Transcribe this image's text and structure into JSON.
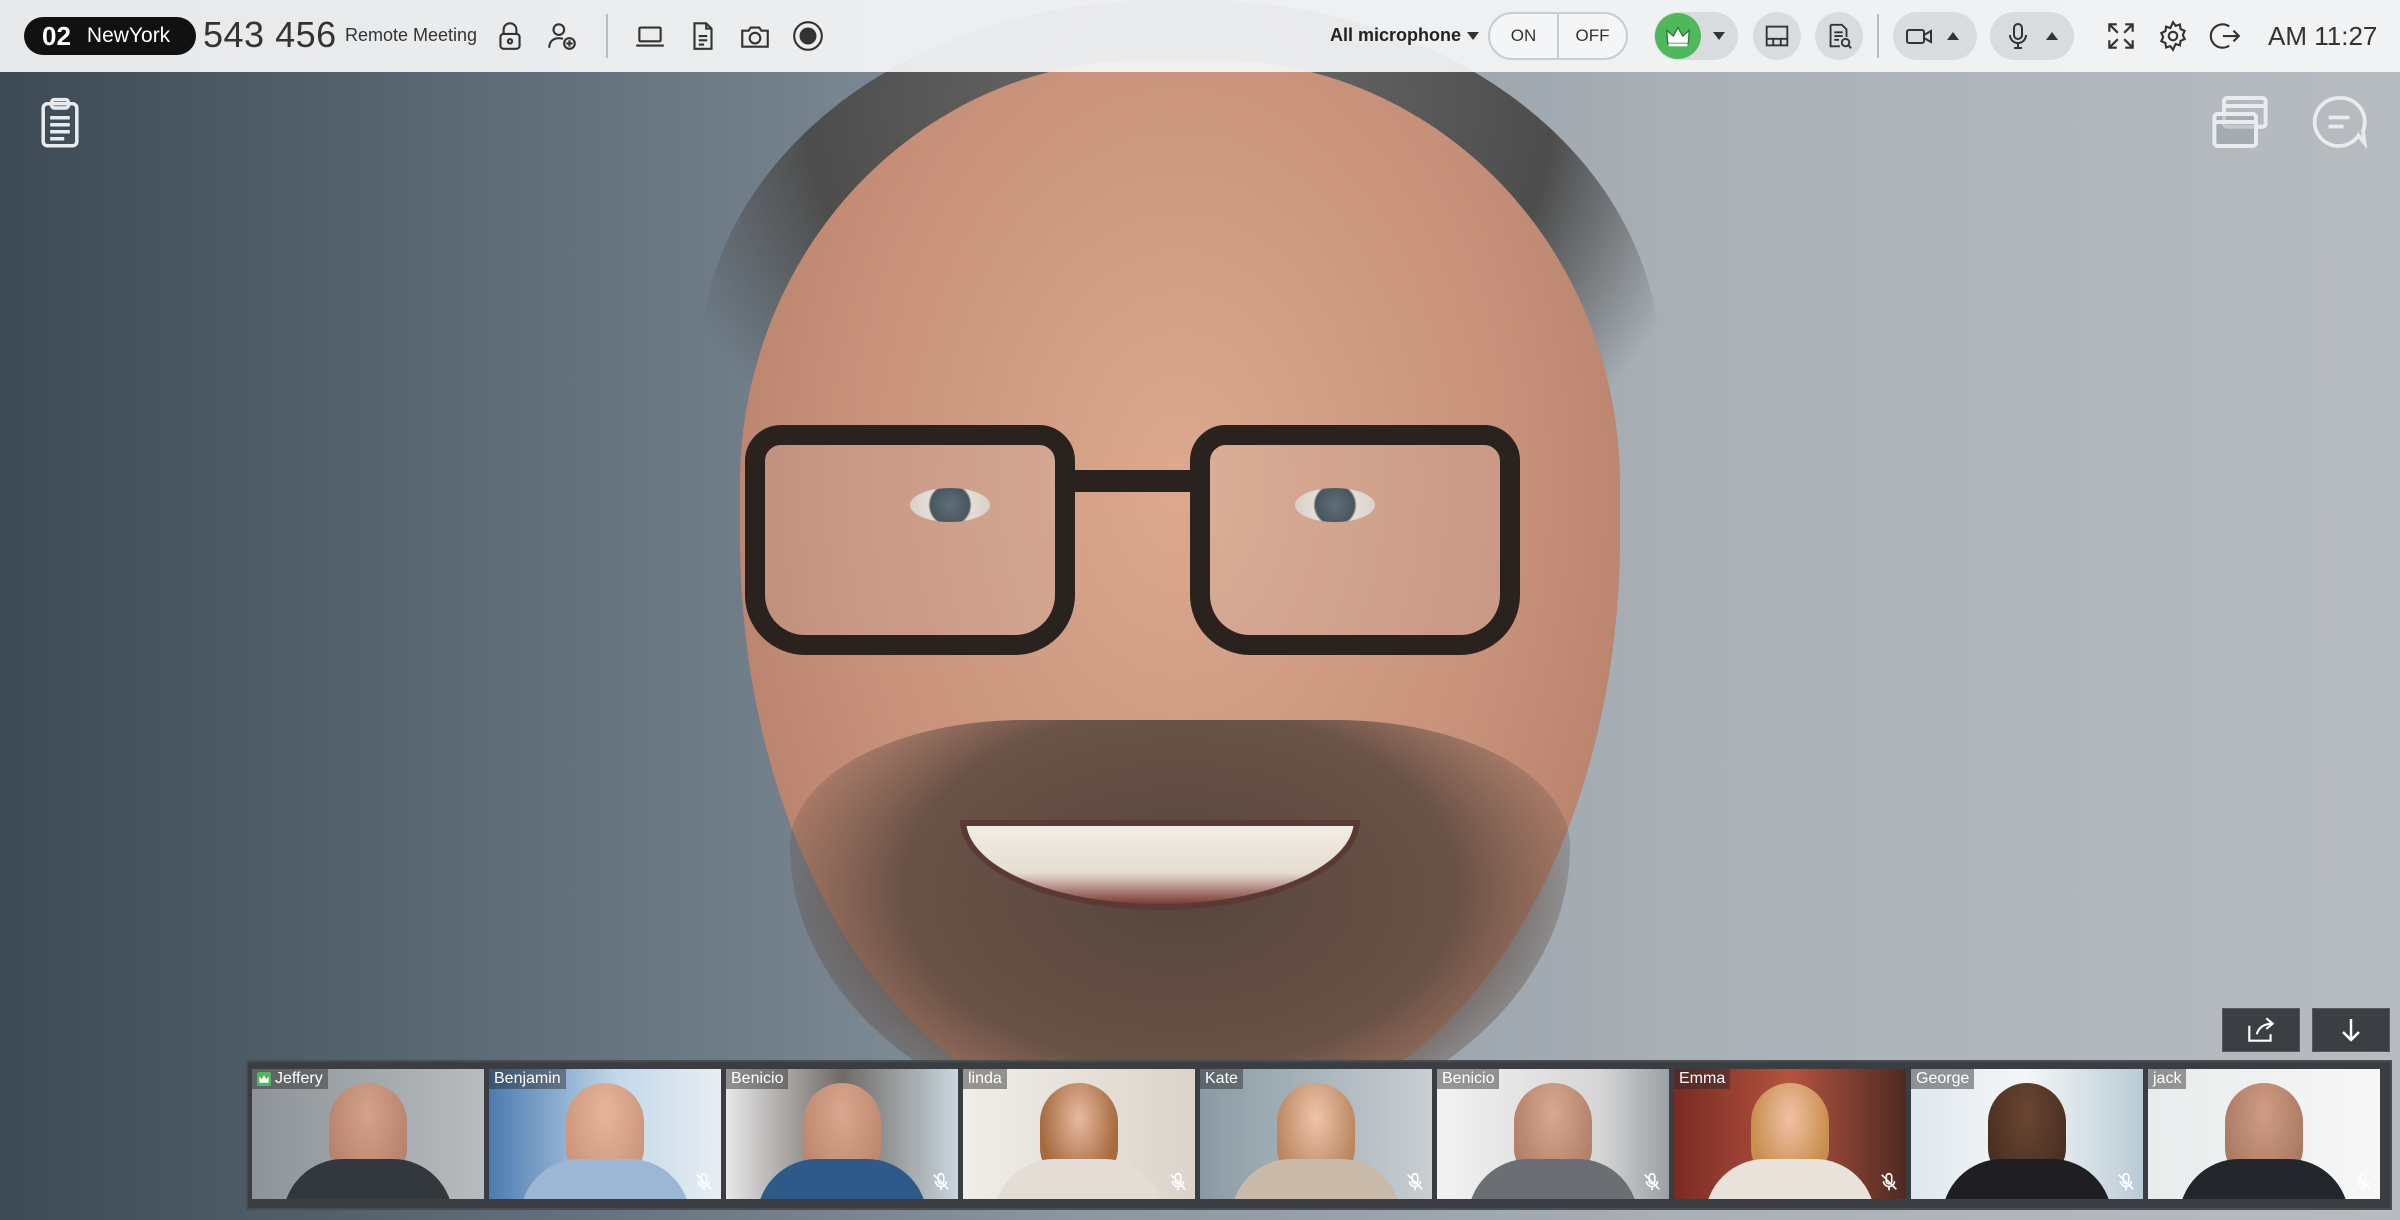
{
  "header": {
    "room_number": "02",
    "room_city": "NewYork",
    "meeting_id": "543 456",
    "meeting_title": "Remote Meeting",
    "microphone_selector": "All microphone",
    "toggle_on": "ON",
    "toggle_off": "OFF",
    "clock": "AM 11:27"
  },
  "icons": {
    "top_left": [
      "lock-icon",
      "add-participant-icon",
      "laptop-icon",
      "document-icon",
      "camera-icon",
      "record-icon"
    ],
    "top_right": [
      "host-crown-icon",
      "layout-icon",
      "file-share-icon",
      "video-camera-icon",
      "microphone-icon",
      "fullscreen-icon",
      "settings-icon",
      "exit-icon"
    ],
    "side": [
      "notes-clipboard-icon",
      "windows-icon",
      "chat-icon"
    ],
    "strip": [
      "share-out-icon",
      "collapse-down-icon"
    ]
  },
  "colors": {
    "host_green": "#4fb85a",
    "toolbar_bg": "#f5f6f7",
    "strip_bg": "#3a3d41"
  },
  "participants": [
    {
      "name": "Jeffery",
      "host": true,
      "muted": false
    },
    {
      "name": "Benjamin",
      "host": false,
      "muted": true
    },
    {
      "name": "Benicio",
      "host": false,
      "muted": true
    },
    {
      "name": "linda",
      "host": false,
      "muted": true
    },
    {
      "name": "Kate",
      "host": false,
      "muted": true
    },
    {
      "name": "Benicio",
      "host": false,
      "muted": true
    },
    {
      "name": "Emma",
      "host": false,
      "muted": true
    },
    {
      "name": "George",
      "host": false,
      "muted": true
    },
    {
      "name": "jack",
      "host": false,
      "muted": true
    }
  ]
}
